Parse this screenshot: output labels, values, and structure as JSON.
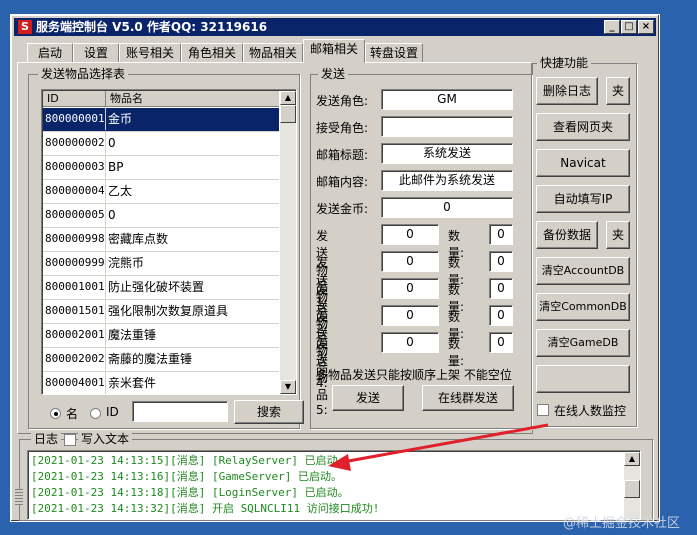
{
  "window": {
    "title": "服务端控制台 V5.0 作者QQ: 32119616"
  },
  "tabs": [
    {
      "label": "启动"
    },
    {
      "label": "设置"
    },
    {
      "label": "账号相关"
    },
    {
      "label": "角色相关"
    },
    {
      "label": "物品相关"
    },
    {
      "label": "邮箱相关"
    },
    {
      "label": "转盘设置"
    }
  ],
  "item_list": {
    "group_label": "发送物品选择表",
    "col_id": "ID",
    "col_name": "物品名",
    "rows": [
      {
        "id": "800000001",
        "name": "金币"
      },
      {
        "id": "800000002",
        "name": "0"
      },
      {
        "id": "800000003",
        "name": "BP"
      },
      {
        "id": "800000004",
        "name": "乙太"
      },
      {
        "id": "800000005",
        "name": "0"
      },
      {
        "id": "800000998",
        "name": "密藏库点数"
      },
      {
        "id": "800000999",
        "name": "浣熊币"
      },
      {
        "id": "800001001",
        "name": "防止强化破坏装置"
      },
      {
        "id": "800001501",
        "name": "强化限制次数复原道具"
      },
      {
        "id": "800002001",
        "name": "魔法重锤"
      },
      {
        "id": "800002002",
        "name": "斋藤的魔法重锤"
      },
      {
        "id": "800004001",
        "name": "亲米套件"
      }
    ],
    "radio_name": "名",
    "radio_id": "ID",
    "search_value": "",
    "search_button": "搜索"
  },
  "send": {
    "group_label": "发送",
    "sender_label": "发送角色:",
    "sender_value": "GM",
    "receiver_label": "接受角色:",
    "receiver_value": "",
    "subject_label": "邮箱标题:",
    "subject_value": "系统发送",
    "content_label": "邮箱内容:",
    "content_value": "此邮件为系统发送",
    "gold_label": "发送金币:",
    "gold_value": "0",
    "items": [
      {
        "label": "发送物品1:",
        "value": "0",
        "qty_label": "数量:",
        "qty": "0"
      },
      {
        "label": "发送物品2:",
        "value": "0",
        "qty_label": "数量:",
        "qty": "0"
      },
      {
        "label": "发送物品3:",
        "value": "0",
        "qty_label": "数量:",
        "qty": "0"
      },
      {
        "label": "发送物品4:",
        "value": "0",
        "qty_label": "数量:",
        "qty": "0"
      },
      {
        "label": "发送物品5:",
        "value": "0",
        "qty_label": "数量:",
        "qty": "0"
      }
    ],
    "note": "多物品发送只能按顺序上架 不能空位",
    "send_button": "发送",
    "group_send_button": "在线群发送"
  },
  "quick": {
    "group_label": "快捷功能",
    "delete_log": "删除日志",
    "folder1": "夹",
    "view_web": "查看网页夹",
    "navicat": "Navicat",
    "auto_ip": "自动填写IP",
    "backup": "备份数据",
    "folder2": "夹",
    "clear_account": "清空AccountDB",
    "clear_common": "清空CommonDB",
    "clear_game": "清空GameDB",
    "online_monitor": "在线人数监控"
  },
  "log": {
    "label": "日志",
    "write_text": "写入文本",
    "lines": [
      "[2021-01-23 14:13:15][消息] [RelayServer] 已启动。",
      "[2021-01-23 14:13:16][消息] [GameServer] 已启动。",
      "[2021-01-23 14:13:18][消息] [LoginServer] 已启动。",
      "[2021-01-23 14:13:32][消息] 开启 SQLNCLI11 访问接口成功!"
    ]
  },
  "watermark": "@稀土掘金技术社区",
  "colors": {
    "accent": "#0a246a",
    "log_text": "#1e8a1e",
    "arrow": "#e0202a"
  }
}
